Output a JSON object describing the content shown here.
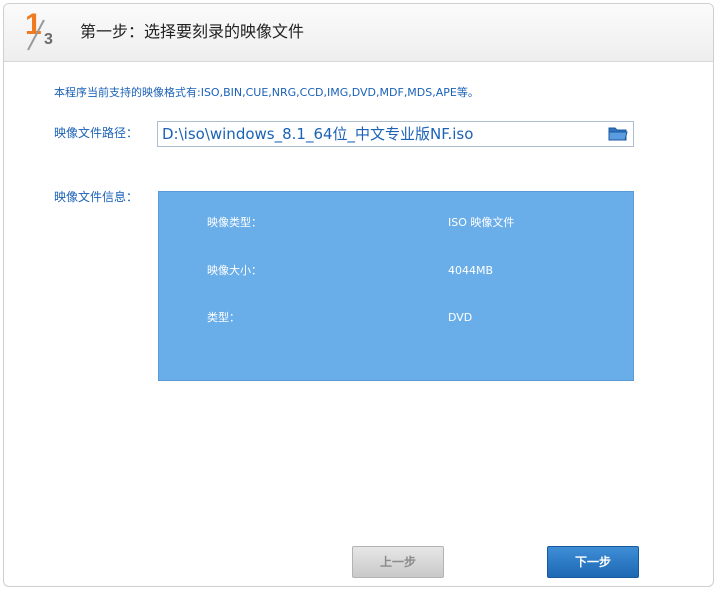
{
  "header": {
    "step_current": "1",
    "step_total": "3",
    "title": "第一步：选择要刻录的映像文件"
  },
  "main": {
    "supported_formats": "本程序当前支持的映像格式有:ISO,BIN,CUE,NRG,CCD,IMG,DVD,MDF,MDS,APE等。",
    "path_label": "映像文件路径：",
    "path_value": "D:\\iso\\windows_8.1_64位_中文专业版NF.iso",
    "browse_icon": "folder-open-icon",
    "info_label": "映像文件信息：",
    "info": [
      {
        "key": "映像类型：",
        "value": "ISO 映像文件"
      },
      {
        "key": "映像大小：",
        "value": "4044MB"
      },
      {
        "key": "类型：",
        "value": "DVD"
      }
    ]
  },
  "footer": {
    "prev_label": "上一步",
    "next_label": "下一步"
  },
  "colors": {
    "accent_orange": "#ef7a1f",
    "label_blue": "#1b62b7",
    "info_panel": "#6aaee9",
    "next_button": "#2a78c4"
  }
}
